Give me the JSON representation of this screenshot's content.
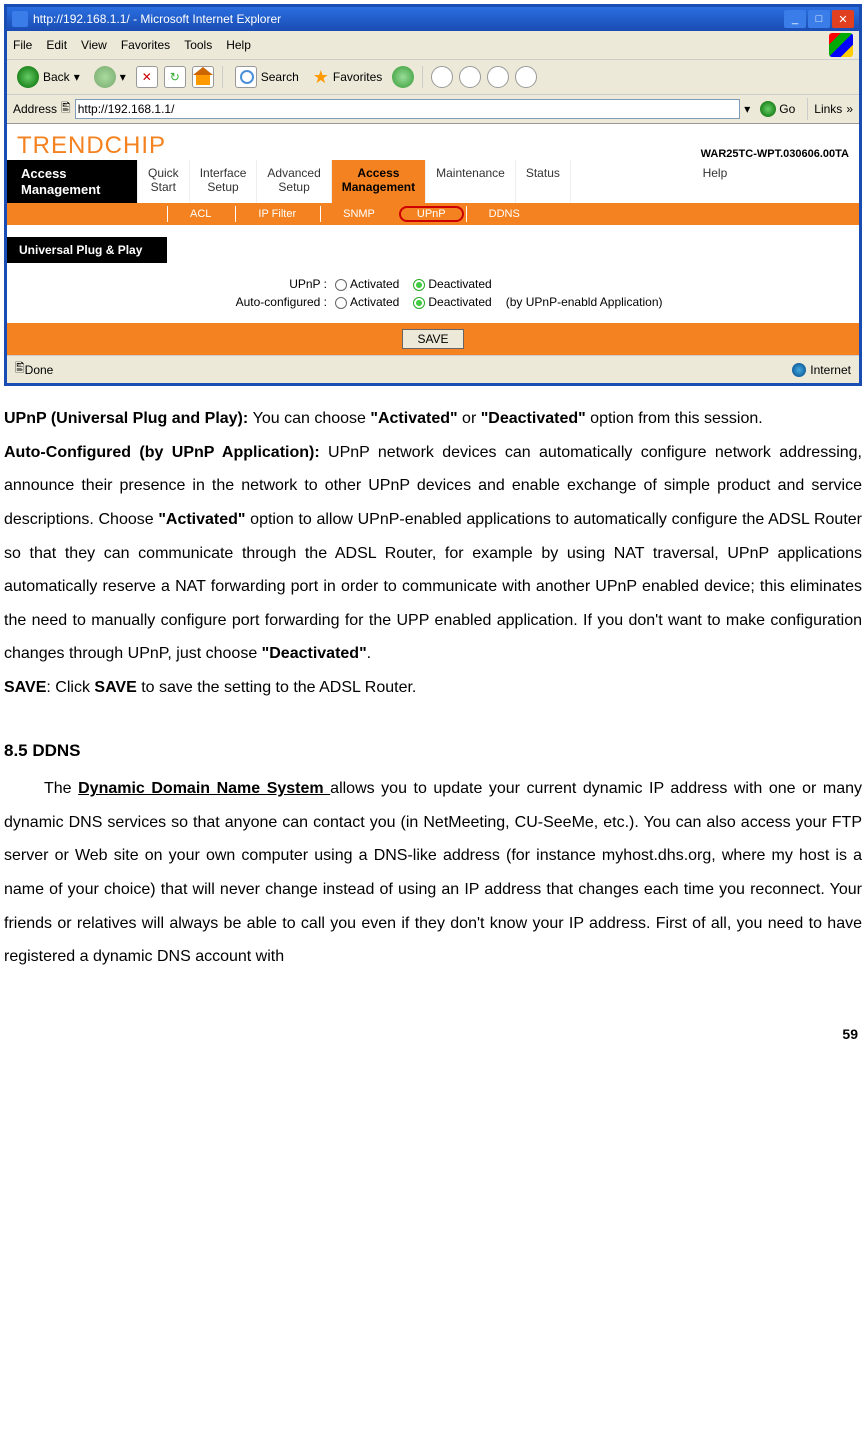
{
  "window": {
    "title": "http://192.168.1.1/ - Microsoft Internet Explorer",
    "menu": {
      "file": "File",
      "edit": "Edit",
      "view": "View",
      "favorites": "Favorites",
      "tools": "Tools",
      "help": "Help"
    },
    "toolbar": {
      "back": "Back",
      "search": "Search",
      "favorites": "Favorites"
    },
    "address_label": "Address",
    "url": "http://192.168.1.1/",
    "go": "Go",
    "links": "Links",
    "status_done": "Done",
    "status_zone": "Internet"
  },
  "router": {
    "brand1": "TREND",
    "brand2": "CHIP",
    "firmware": "WAR25TC-WPT.030606.00TA",
    "active_section": "Access\nManagement",
    "tabs": {
      "quick": "Quick\nStart",
      "interface": "Interface\nSetup",
      "advanced": "Advanced\nSetup",
      "access": "Access\nManagement",
      "maintenance": "Maintenance",
      "status": "Status",
      "help": "Help"
    },
    "subtabs": {
      "acl": "ACL",
      "ipfilter": "IP Filter",
      "snmp": "SNMP",
      "upnp": "UPnP",
      "ddns": "DDNS"
    },
    "section": "Universal Plug & Play",
    "upnp_label": "UPnP :",
    "auto_label": "Auto-configured :",
    "opt_activated": "Activated",
    "opt_deactivated": "Deactivated",
    "auto_suffix": "(by UPnP-enabld Application)",
    "save": "SAVE"
  },
  "doc": {
    "p1_b": "UPnP (Universal Plug and Play): ",
    "p1_a": "You can choose ",
    "p1_q1": "\"Activated\"",
    "p1_or": " or ",
    "p1_q2": "\"Deactivated\"",
    "p1_end": " option from this session.",
    "p2_b": "Auto-Configured (by UPnP Application): ",
    "p2_a": "UPnP network devices can automatically configure network addressing, announce their presence in the network to other UPnP devices and enable exchange of simple product and service descriptions. Choose ",
    "p2_q1": "\"Activated\"",
    "p2_b2": " option to allow UPnP-enabled applications to automatically configure the ADSL Router so that they can communicate through the ADSL Router, for example by using NAT traversal, UPnP applications automatically reserve a NAT forwarding port in order to communicate with another UPnP enabled device; this eliminates the need to manually configure port forwarding for the UPP enabled application.   If you don't want to make configuration changes through UPnP, just choose ",
    "p2_q2": "\"Deactivated\"",
    "p2_dot": ".",
    "p3_b": "SAVE",
    "p3_a": ": Click ",
    "p3_b2": "SAVE",
    "p3_c": " to save the setting to the ADSL Router.",
    "h2": "8.5 DDNS",
    "p4_a": "The ",
    "p4_u": "Dynamic Domain Name System ",
    "p4_b": "allows you to update your current dynamic IP address with one or many dynamic DNS services so that anyone can contact you (in NetMeeting, CU-SeeMe, etc.). You can also access your FTP server or Web site on your own computer using a DNS-like address (for instance myhost.dhs.org, where my host is a name of your choice) that will never change instead of using an IP address that changes each time you reconnect. Your friends or relatives will always be able to call you even if they don't know your IP address. First of all, you need to have registered a dynamic DNS account with",
    "page": "59"
  }
}
